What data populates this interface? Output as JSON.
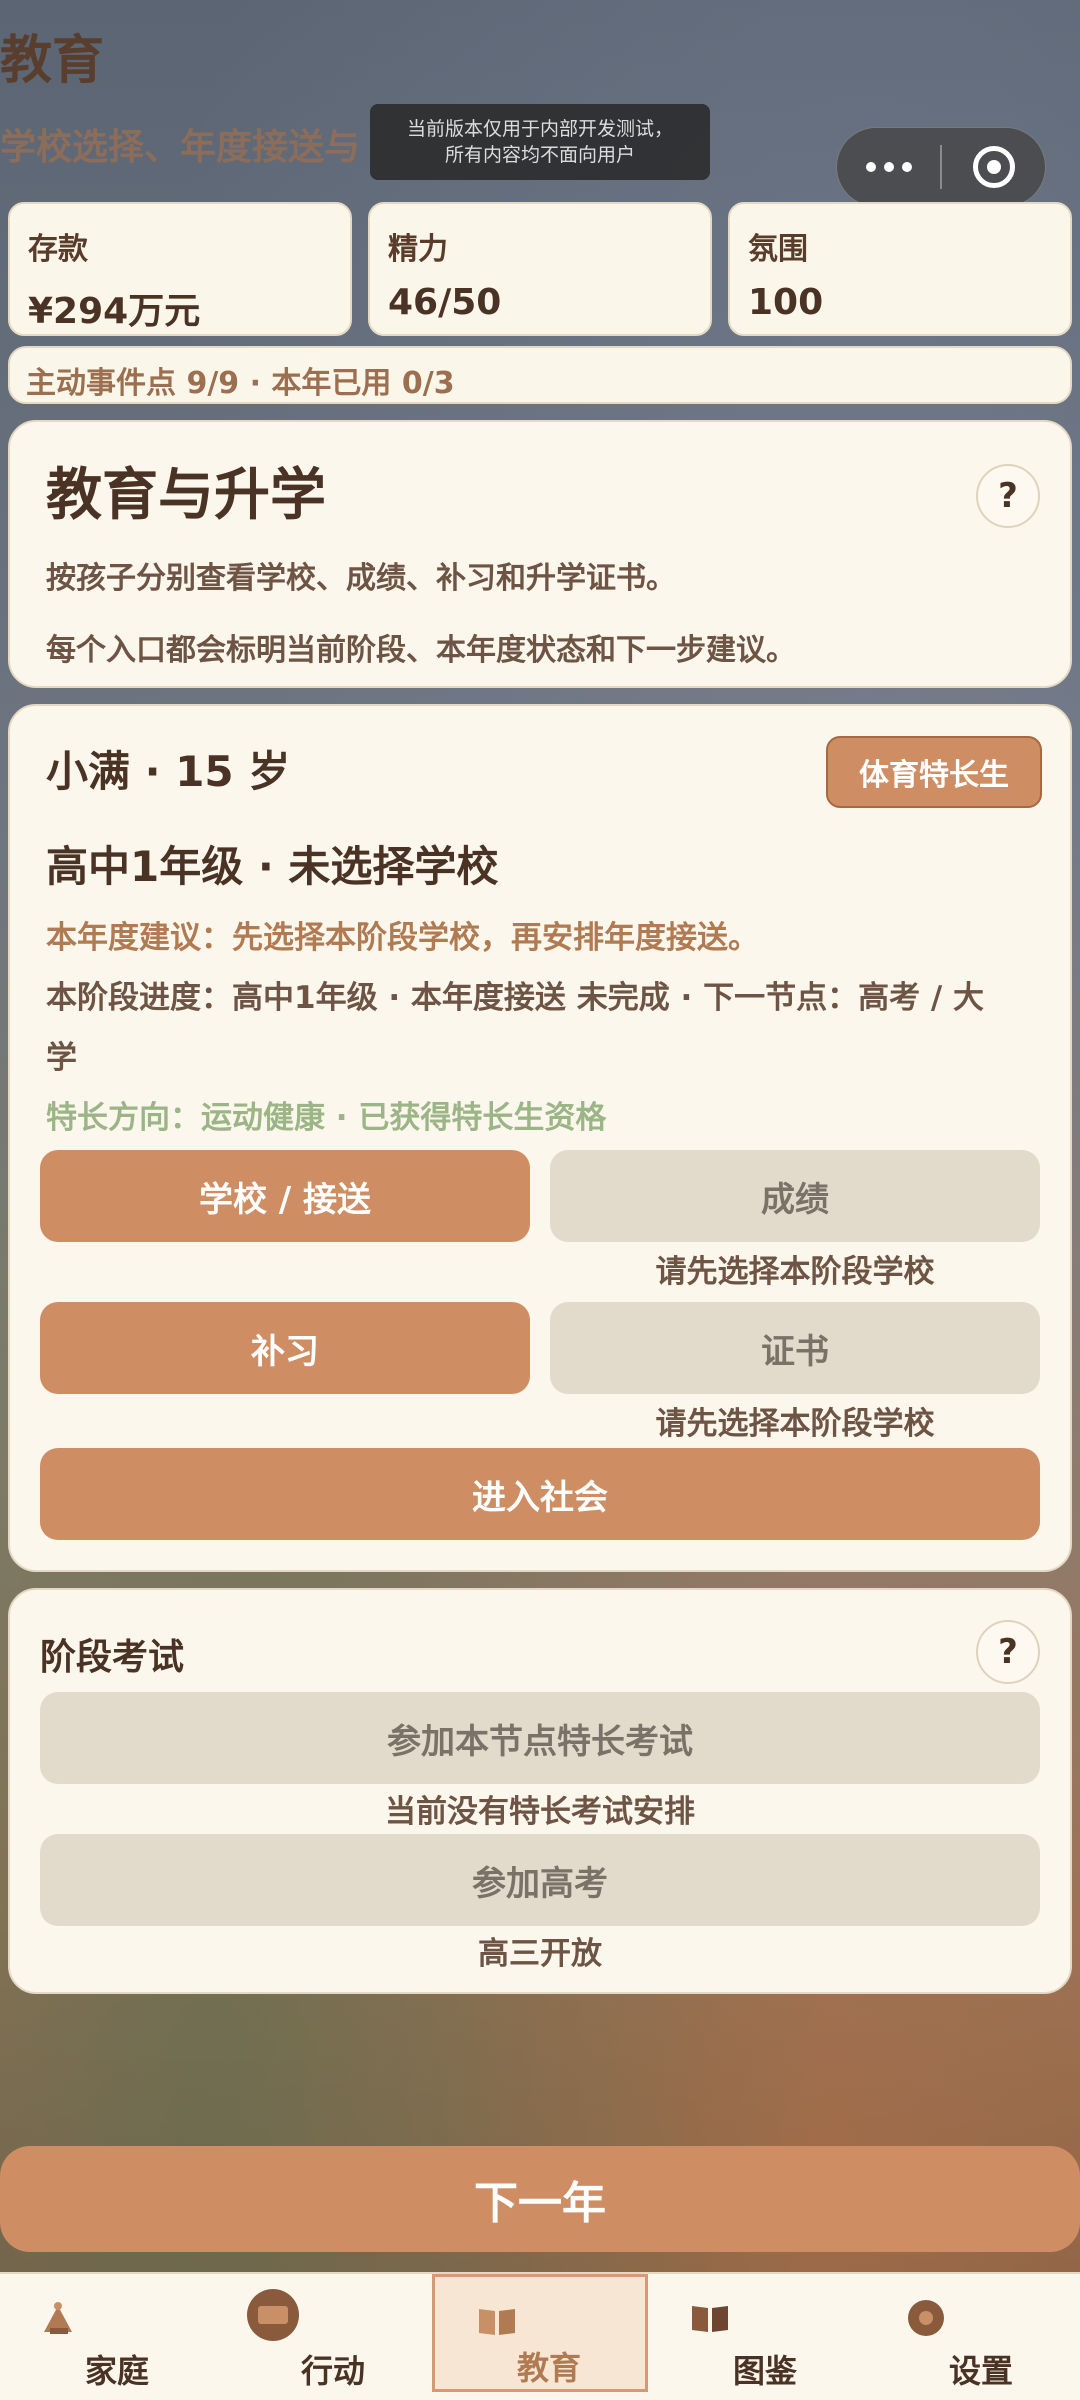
{
  "header": {
    "title": "教育",
    "subtitle": "学校选择、年度接送与",
    "dev_notice_line1": "当前版本仅用于内部开发测试，",
    "dev_notice_line2": "所有内容均不面向用户"
  },
  "stats": [
    {
      "label": "存款",
      "value": "¥294万元"
    },
    {
      "label": "精力",
      "value": "46/50"
    },
    {
      "label": "氛围",
      "value": "100"
    }
  ],
  "event_bar": "主动事件点 9/9 · 本年已用 0/3",
  "intro": {
    "title": "教育与升学",
    "help": "?",
    "line1": "按孩子分别查看学校、成绩、补习和升学证书。",
    "line2": "每个入口都会标明当前阶段、本年度状态和下一步建议。"
  },
  "child": {
    "name_age": "小满 · 15 岁",
    "grade_school": "高中1年级 · 未选择学校",
    "tag": "体育特长生",
    "suggestion": "本年度建议：先选择本阶段学校，再安排年度接送。",
    "progress_line1": "本阶段进度：高中1年级 · 本年度接送 未完成 · 下一节点：高考 / 大",
    "progress_line2": "学",
    "talent": "特长方向：运动健康 · 已获得特长生资格",
    "btn_school": "学校 / 接送",
    "btn_grades": "成绩",
    "grades_hint": "请先选择本阶段学校",
    "btn_tutoring": "补习",
    "btn_certificate": "证书",
    "certificate_hint": "请先选择本阶段学校",
    "btn_society": "进入社会"
  },
  "exam": {
    "title": "阶段考试",
    "help": "?",
    "btn_talent_exam": "参加本节点特长考试",
    "talent_exam_hint": "当前没有特长考试安排",
    "btn_gaokao": "参加高考",
    "gaokao_hint": "高三开放"
  },
  "next_year": "下一年",
  "tabs": [
    {
      "label": "家庭",
      "icon": "family-icon"
    },
    {
      "label": "行动",
      "icon": "action-icon"
    },
    {
      "label": "教育",
      "icon": "book-icon",
      "active": true
    },
    {
      "label": "图鉴",
      "icon": "book-icon"
    },
    {
      "label": "设置",
      "icon": "settings-icon"
    }
  ],
  "colors": {
    "accent": "#cf8d63",
    "card": "#fcf7ec",
    "text": "#4a3325",
    "talent": "#9cb587"
  }
}
